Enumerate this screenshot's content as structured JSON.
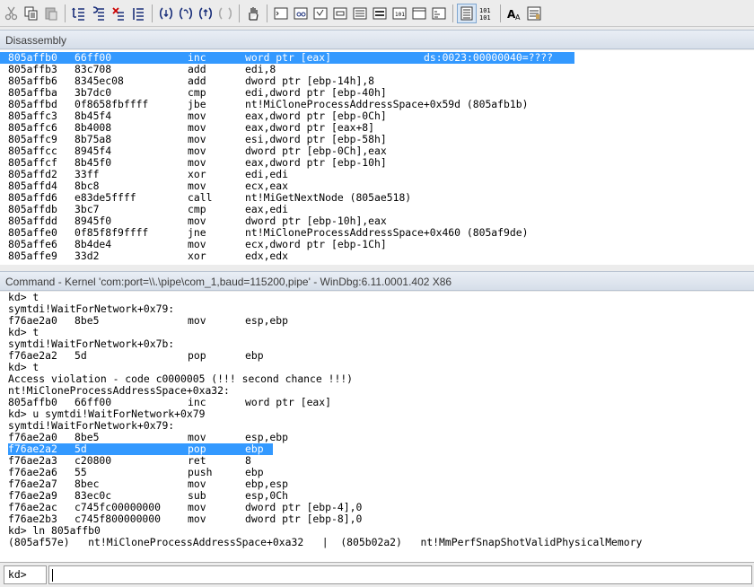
{
  "toolbar": {
    "buttons": [
      {
        "icon": "cut-icon"
      },
      {
        "icon": "copy-icon"
      },
      {
        "icon": "paste-icon"
      },
      {
        "icon": "step-out-back-icon"
      },
      {
        "icon": "step-into-icon"
      },
      {
        "icon": "step-over-icon"
      },
      {
        "icon": "run-to-cursor-icon"
      },
      {
        "icon": "step-into-source-icon"
      },
      {
        "icon": "step-over-source-icon"
      },
      {
        "icon": "step-out-source-icon"
      },
      {
        "icon": "step-disabled-icon"
      },
      {
        "icon": "hand-icon"
      },
      {
        "icon": "command-window-icon"
      },
      {
        "icon": "watch-window-icon"
      },
      {
        "icon": "locals-window-icon"
      },
      {
        "icon": "registers-window-icon"
      },
      {
        "icon": "memory-window-icon"
      },
      {
        "icon": "call-stack-icon"
      },
      {
        "icon": "disassembly-window-icon"
      },
      {
        "icon": "scratch-pad-icon"
      },
      {
        "icon": "processes-threads-icon"
      },
      {
        "icon": "source-mode-icon"
      },
      {
        "icon": "hex-display-icon"
      },
      {
        "icon": "font-icon"
      },
      {
        "icon": "options-icon"
      }
    ]
  },
  "disassembly": {
    "title": "Disassembly",
    "rows": [
      {
        "addr": "805affb0",
        "bytes": "66ff00",
        "mnem": "inc",
        "ops": "word ptr [eax]",
        "extra": "ds:0023:00000040=????"
      },
      {
        "addr": "805affb3",
        "bytes": "83c708",
        "mnem": "add",
        "ops": "edi,8",
        "extra": ""
      },
      {
        "addr": "805affb6",
        "bytes": "8345ec08",
        "mnem": "add",
        "ops": "dword ptr [ebp-14h],8",
        "extra": ""
      },
      {
        "addr": "805affba",
        "bytes": "3b7dc0",
        "mnem": "cmp",
        "ops": "edi,dword ptr [ebp-40h]",
        "extra": ""
      },
      {
        "addr": "805affbd",
        "bytes": "0f8658fbffff",
        "mnem": "jbe",
        "ops": "nt!MiCloneProcessAddressSpace+0x59d (805afb1b)",
        "extra": ""
      },
      {
        "addr": "805affc3",
        "bytes": "8b45f4",
        "mnem": "mov",
        "ops": "eax,dword ptr [ebp-0Ch]",
        "extra": ""
      },
      {
        "addr": "805affc6",
        "bytes": "8b4008",
        "mnem": "mov",
        "ops": "eax,dword ptr [eax+8]",
        "extra": ""
      },
      {
        "addr": "805affc9",
        "bytes": "8b75a8",
        "mnem": "mov",
        "ops": "esi,dword ptr [ebp-58h]",
        "extra": ""
      },
      {
        "addr": "805affcc",
        "bytes": "8945f4",
        "mnem": "mov",
        "ops": "dword ptr [ebp-0Ch],eax",
        "extra": ""
      },
      {
        "addr": "805affcf",
        "bytes": "8b45f0",
        "mnem": "mov",
        "ops": "eax,dword ptr [ebp-10h]",
        "extra": ""
      },
      {
        "addr": "805affd2",
        "bytes": "33ff",
        "mnem": "xor",
        "ops": "edi,edi",
        "extra": ""
      },
      {
        "addr": "805affd4",
        "bytes": "8bc8",
        "mnem": "mov",
        "ops": "ecx,eax",
        "extra": ""
      },
      {
        "addr": "805affd6",
        "bytes": "e83de5ffff",
        "mnem": "call",
        "ops": "nt!MiGetNextNode (805ae518)",
        "extra": ""
      },
      {
        "addr": "805affdb",
        "bytes": "3bc7",
        "mnem": "cmp",
        "ops": "eax,edi",
        "extra": ""
      },
      {
        "addr": "805affdd",
        "bytes": "8945f0",
        "mnem": "mov",
        "ops": "dword ptr [ebp-10h],eax",
        "extra": ""
      },
      {
        "addr": "805affe0",
        "bytes": "0f85f8f9ffff",
        "mnem": "jne",
        "ops": "nt!MiCloneProcessAddressSpace+0x460 (805af9de)",
        "extra": ""
      },
      {
        "addr": "805affe6",
        "bytes": "8b4de4",
        "mnem": "mov",
        "ops": "ecx,dword ptr [ebp-1Ch]",
        "extra": ""
      },
      {
        "addr": "805affe9",
        "bytes": "33d2",
        "mnem": "xor",
        "ops": "edx,edx",
        "extra": ""
      }
    ]
  },
  "command": {
    "title": "Command - Kernel 'com:port=\\\\.\\pipe\\com_1,baud=115200,pipe' - WinDbg:6.11.0001.402 X86",
    "lines": [
      {
        "type": "text",
        "text": "kd> t"
      },
      {
        "type": "text",
        "text": "symtdi!WaitForNetwork+0x79:"
      },
      {
        "type": "asm",
        "addr": "f76ae2a0",
        "bytes": "8be5",
        "mnem": "mov",
        "ops": "esp,ebp"
      },
      {
        "type": "text",
        "text": "kd> t"
      },
      {
        "type": "text",
        "text": "symtdi!WaitForNetwork+0x7b:"
      },
      {
        "type": "asm",
        "addr": "f76ae2a2",
        "bytes": "5d",
        "mnem": "pop",
        "ops": "ebp"
      },
      {
        "type": "text",
        "text": "kd> t"
      },
      {
        "type": "text",
        "text": "Access violation - code c0000005 (!!! second chance !!!)"
      },
      {
        "type": "text",
        "text": "nt!MiCloneProcessAddressSpace+0xa32:"
      },
      {
        "type": "asm",
        "addr": "805affb0",
        "bytes": "66ff00",
        "mnem": "inc",
        "ops": "word ptr [eax]"
      },
      {
        "type": "text",
        "text": "kd> u symtdi!WaitForNetwork+0x79"
      },
      {
        "type": "text",
        "text": "symtdi!WaitForNetwork+0x79:"
      },
      {
        "type": "asm",
        "addr": "f76ae2a0",
        "bytes": "8be5",
        "mnem": "mov",
        "ops": "esp,ebp"
      },
      {
        "type": "asm",
        "addr": "f76ae2a2",
        "bytes": "5d",
        "mnem": "pop",
        "ops": "ebp",
        "highlight": true
      },
      {
        "type": "asm",
        "addr": "f76ae2a3",
        "bytes": "c20800",
        "mnem": "ret",
        "ops": "8"
      },
      {
        "type": "asm",
        "addr": "f76ae2a6",
        "bytes": "55",
        "mnem": "push",
        "ops": "ebp"
      },
      {
        "type": "asm",
        "addr": "f76ae2a7",
        "bytes": "8bec",
        "mnem": "mov",
        "ops": "ebp,esp"
      },
      {
        "type": "asm",
        "addr": "f76ae2a9",
        "bytes": "83ec0c",
        "mnem": "sub",
        "ops": "esp,0Ch"
      },
      {
        "type": "asm",
        "addr": "f76ae2ac",
        "bytes": "c745fc00000000",
        "mnem": "mov",
        "ops": "dword ptr [ebp-4],0"
      },
      {
        "type": "asm",
        "addr": "f76ae2b3",
        "bytes": "c745f800000000",
        "mnem": "mov",
        "ops": "dword ptr [ebp-8],0"
      },
      {
        "type": "text",
        "text": "kd> ln 805affb0"
      },
      {
        "type": "text",
        "text": "(805af57e)   nt!MiCloneProcessAddressSpace+0xa32   |  (805b02a2)   nt!MmPerfSnapShotValidPhysicalMemory"
      }
    ],
    "prompt": "kd>",
    "input_value": ""
  },
  "colors": {
    "highlight": "#3399ff",
    "title_bar": "#d6dee9"
  }
}
